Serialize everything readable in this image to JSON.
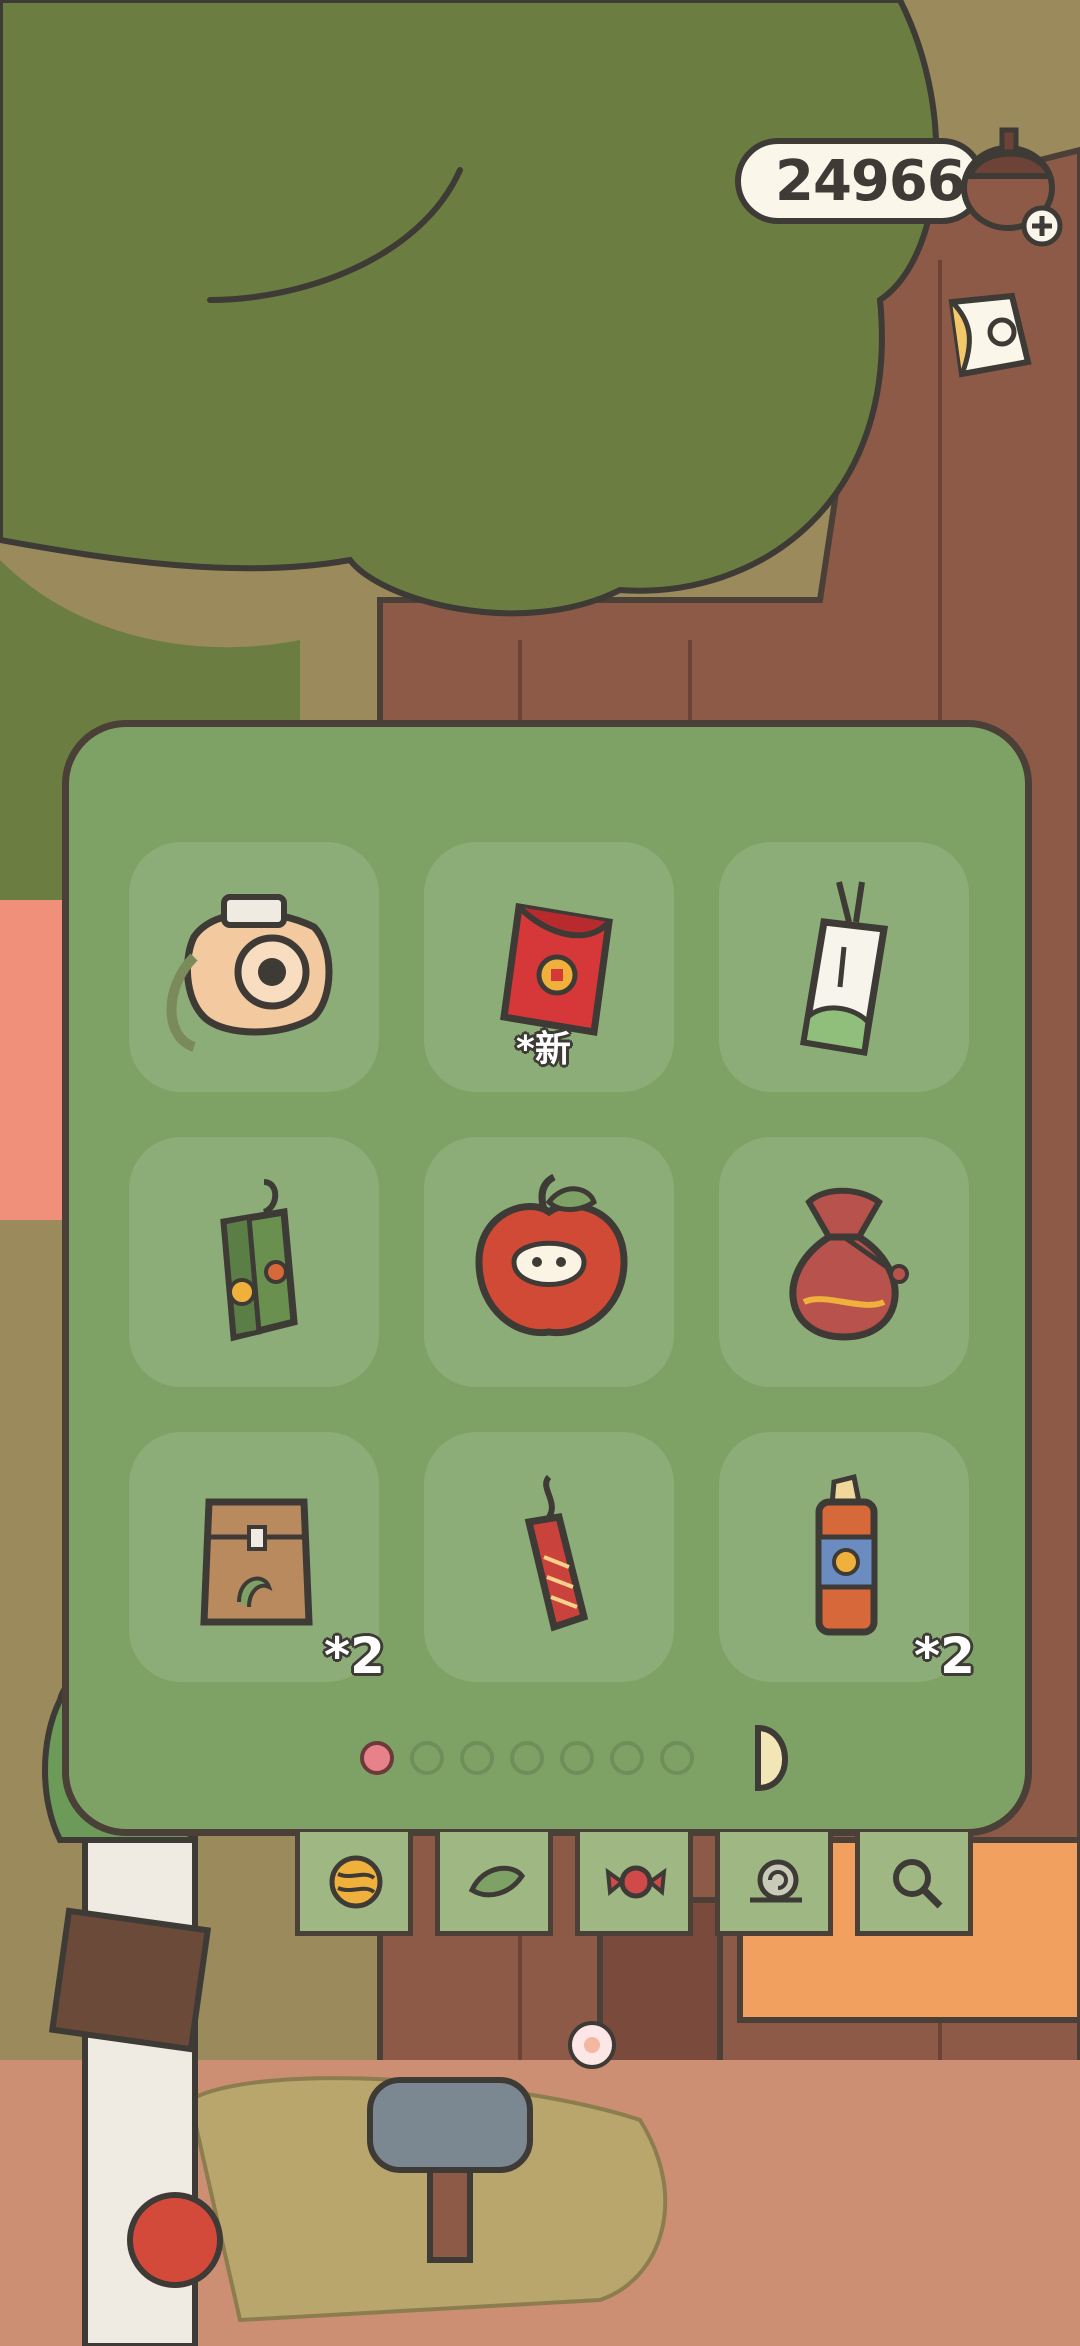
{
  "hud": {
    "clover_count": "24966",
    "add_icon": "plus-icon",
    "memo_icon": "note-icon"
  },
  "inventory": {
    "page_count": 7,
    "current_page": 1,
    "items": [
      {
        "name": "camera",
        "icon": "camera-icon",
        "badge": ""
      },
      {
        "name": "red-envelope",
        "icon": "red-envelope-icon",
        "badge": "*新"
      },
      {
        "name": "fortune-slip",
        "icon": "fortune-slip-icon",
        "badge": ""
      },
      {
        "name": "lantern-bag",
        "icon": "lantern-icon",
        "badge": ""
      },
      {
        "name": "apple-mask",
        "icon": "apple-icon",
        "badge": ""
      },
      {
        "name": "lucky-pouch",
        "icon": "pouch-icon",
        "badge": ""
      },
      {
        "name": "paper-bag",
        "icon": "bag-icon",
        "badge": "*2"
      },
      {
        "name": "firecracker",
        "icon": "firecracker-icon",
        "badge": ""
      },
      {
        "name": "drink-can",
        "icon": "can-icon",
        "badge": "*2"
      }
    ]
  },
  "tabs": [
    {
      "icon": "yarn-ball-icon"
    },
    {
      "icon": "leaf-icon"
    },
    {
      "icon": "candy-icon"
    },
    {
      "icon": "snail-icon"
    },
    {
      "icon": "magnifier-icon"
    }
  ],
  "colors": {
    "panel": "#7ea266",
    "outline": "#4a4037",
    "active_dot": "#e8828a"
  }
}
